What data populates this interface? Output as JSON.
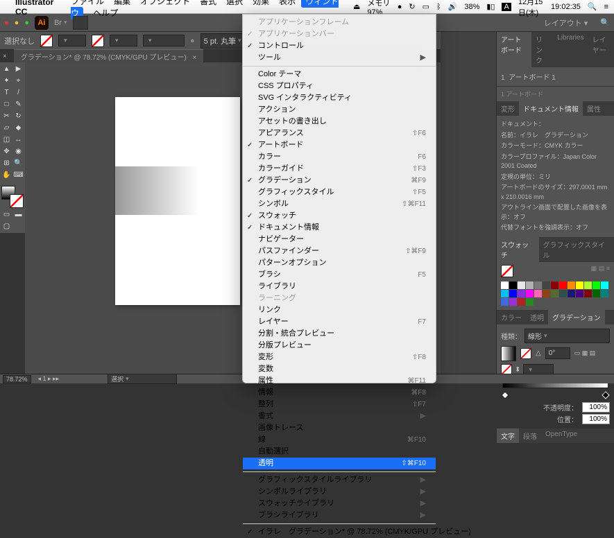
{
  "menubar": {
    "app": "Illustrator CC",
    "items": [
      "ファイル",
      "編集",
      "オブジェクト",
      "書式",
      "選択",
      "効果",
      "表示",
      "ウィンドウ",
      "ヘルプ"
    ],
    "open_index": 7,
    "right": {
      "mem": "メモリ 97%",
      "battery": "38%",
      "plug": "⚡",
      "date": "12月15日(木)",
      "time": "19:02:35"
    }
  },
  "topbar": {
    "logo": "Ai",
    "layout": "レイアウト ▾"
  },
  "control": {
    "noselect": "選択なし",
    "stroke_field": "5 pt. 丸筆"
  },
  "doctab": "グラデーション* @ 78.72% (CMYK/GPU プレビュー)",
  "status": {
    "zoom": "78.72%",
    "tool": "選択"
  },
  "artboards": {
    "tabs": [
      "アートボード",
      "リンク",
      "Libraries",
      "レイヤー"
    ],
    "list": [
      {
        "num": "1",
        "name": "アートボード 1"
      }
    ],
    "count": "1 アートボード"
  },
  "docinfo": {
    "tabs": [
      "変形",
      "ドキュメント情報",
      "属性"
    ],
    "rows": [
      "ドキュメント：",
      "名前：イラレ　グラデーション",
      "カラーモード：CMYK カラー",
      "カラープロファイル：Japan Color 2001 Coated",
      "定規の単位：ミリ",
      "アートボードのサイズ：297.0001 mm x 210.0016 mm",
      "アウトライン画面で配置した画像を表示：オフ",
      "代替フォントを強調表示：オフ"
    ]
  },
  "swatches_tabs": [
    "スウォッチ",
    "グラフィックスタイル"
  ],
  "grad_panel": {
    "tabs": [
      "カラー",
      "透明",
      "グラデーション"
    ],
    "type_label": "種類：",
    "type_value": "線形",
    "angle_label": "△",
    "angle_value": "0°",
    "opacity_label": "不透明度：",
    "opacity_value": "100%",
    "position_label": "位置：",
    "position_value": "100%"
  },
  "bottom_tabs": [
    "文字",
    "段落",
    "OpenType"
  ],
  "window_menu": [
    {
      "t": "アプリケーションフレーム",
      "disabled": true
    },
    {
      "t": "アプリケーションバー",
      "disabled": true,
      "check": true
    },
    {
      "t": "コントロール",
      "check": true
    },
    {
      "t": "ツール",
      "sub": true
    },
    {
      "sep": true
    },
    {
      "t": "Color テーマ"
    },
    {
      "t": "CSS プロパティ"
    },
    {
      "t": "SVG インタラクティビティ"
    },
    {
      "t": "アクション"
    },
    {
      "t": "アセットの書き出し"
    },
    {
      "t": "アピアランス",
      "sc": "⇧F6"
    },
    {
      "t": "アートボード",
      "check": true
    },
    {
      "t": "カラー",
      "sc": "F6"
    },
    {
      "t": "カラーガイド",
      "sc": "⇧F3"
    },
    {
      "t": "グラデーション",
      "check": true,
      "sc": "⌘F9"
    },
    {
      "t": "グラフィックスタイル",
      "sc": "⇧F5"
    },
    {
      "t": "シンボル",
      "sc": "⇧⌘F11"
    },
    {
      "t": "スウォッチ",
      "check": true
    },
    {
      "t": "ドキュメント情報",
      "check": true
    },
    {
      "t": "ナビゲーター"
    },
    {
      "t": "パスファインダー",
      "sc": "⇧⌘F9"
    },
    {
      "t": "パターンオプション"
    },
    {
      "t": "ブラシ",
      "sc": "F5"
    },
    {
      "t": "ライブラリ"
    },
    {
      "t": "ラーニング",
      "disabled": true
    },
    {
      "t": "リンク"
    },
    {
      "t": "レイヤー",
      "sc": "F7"
    },
    {
      "t": "分割・統合プレビュー"
    },
    {
      "t": "分版プレビュー"
    },
    {
      "t": "変形",
      "sc": "⇧F8"
    },
    {
      "t": "変数"
    },
    {
      "t": "属性",
      "sc": "⌘F11"
    },
    {
      "t": "情報",
      "sc": "⌘F8"
    },
    {
      "t": "整列",
      "sc": "⇧F7"
    },
    {
      "t": "書式",
      "sub": true
    },
    {
      "t": "画像トレース"
    },
    {
      "t": "線",
      "sc": "⌘F10"
    },
    {
      "t": "自動選択"
    },
    {
      "t": "透明",
      "sc": "⇧⌘F10",
      "hl": true
    },
    {
      "sep": true
    },
    {
      "t": "グラフィックスタイルライブラリ",
      "sub": true
    },
    {
      "t": "シンボルライブラリ",
      "sub": true
    },
    {
      "t": "スウォッチライブラリ",
      "sub": true
    },
    {
      "t": "ブラシライブラリ",
      "sub": true
    },
    {
      "sep": true
    },
    {
      "t": "イラレ　グラデーション* @ 78.72% (CMYK/GPU プレビュー)",
      "check": true
    }
  ],
  "swatch_colors": [
    "#fff",
    "#000",
    "#e7e7e7",
    "#b0b0b0",
    "#7a7a7a",
    "#444",
    "#8b0000",
    "#f00",
    "#ff8c00",
    "#ff0",
    "#adff2f",
    "#0f0",
    "#0ff",
    "#00bfff",
    "#00f",
    "#8a2be2",
    "#f0f",
    "#ff69b4",
    "#8b4513",
    "#556b2f",
    "#2f4f4f",
    "#191970",
    "#4b0082",
    "#800000",
    "#006400",
    "#008080",
    "#4169e1",
    "#9932cc",
    "#b22222",
    "#228b22"
  ]
}
